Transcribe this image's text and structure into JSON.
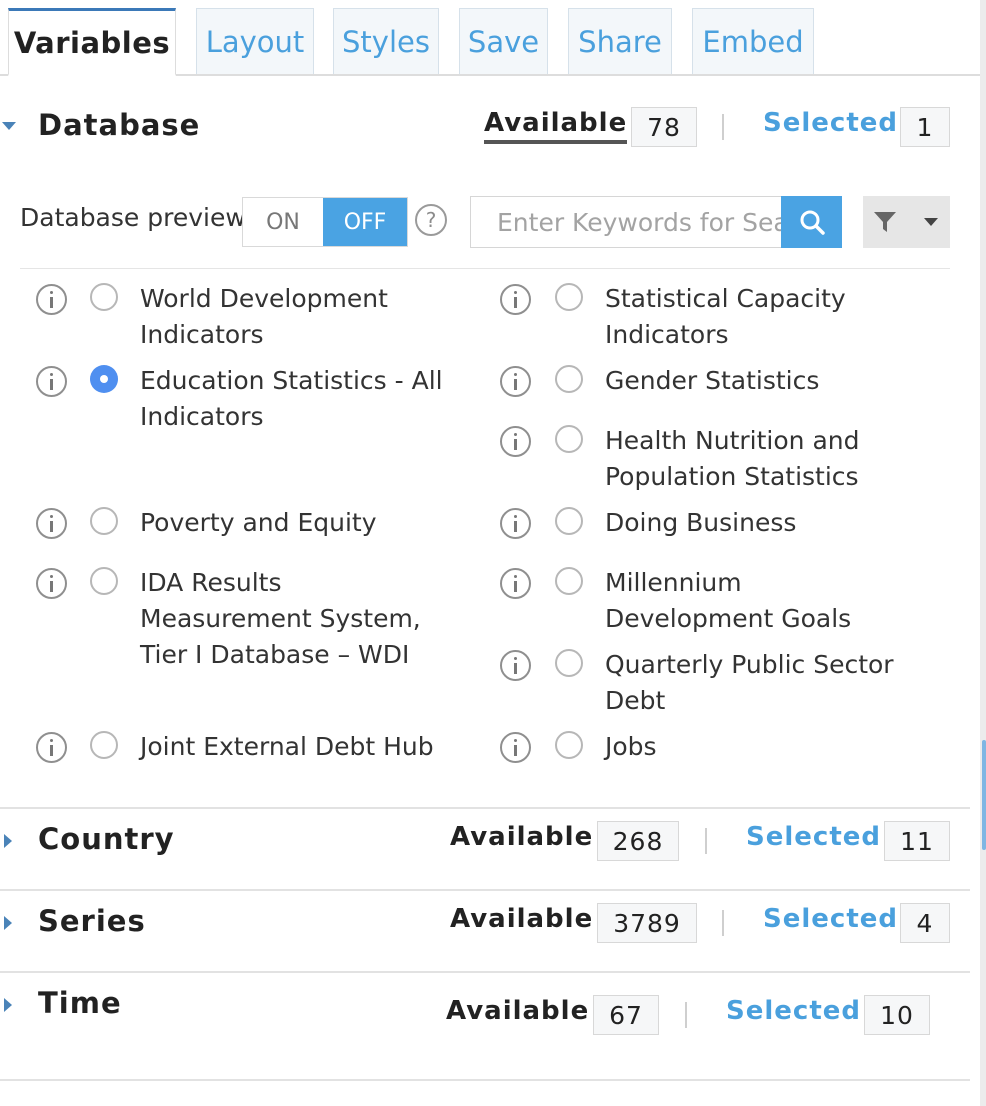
{
  "tabs": [
    "Variables",
    "Layout",
    "Styles",
    "Save",
    "Share",
    "Embed"
  ],
  "database": {
    "title": "Database",
    "available_label": "Available",
    "available_count": "78",
    "selected_label": "Selected",
    "selected_count": "1",
    "preview_label": "Database preview",
    "toggle_on": "ON",
    "toggle_off": "OFF",
    "search_placeholder": "Enter Keywords for Search",
    "items": [
      {
        "label": "World Development Indicators",
        "selected": false
      },
      {
        "label": "Statistical Capacity Indicators",
        "selected": false
      },
      {
        "label": "Education Statistics - All Indicators",
        "selected": true
      },
      {
        "label": "Gender Statistics",
        "selected": false
      },
      {
        "label": "Health Nutrition and Population Statistics",
        "selected": false
      },
      {
        "label": "Poverty and Equity",
        "selected": false
      },
      {
        "label": "Doing Business",
        "selected": false
      },
      {
        "label": "IDA Results Measurement System, Tier I Database – WDI",
        "selected": false
      },
      {
        "label": "Millennium Development Goals",
        "selected": false
      },
      {
        "label": "Quarterly Public Sector Debt",
        "selected": false
      },
      {
        "label": "Joint External Debt Hub",
        "selected": false
      },
      {
        "label": "Jobs",
        "selected": false
      }
    ]
  },
  "country": {
    "title": "Country",
    "available_label": "Available",
    "available_count": "268",
    "selected_label": "Selected",
    "selected_count": "11"
  },
  "series": {
    "title": "Series",
    "available_label": "Available",
    "available_count": "3789",
    "selected_label": "Selected",
    "selected_count": "4"
  },
  "time": {
    "title": "Time",
    "available_label": "Available",
    "available_count": "67",
    "selected_label": "Selected",
    "selected_count": "10"
  },
  "colors": {
    "accent": "#4aa3e3",
    "link": "#4aa0dd",
    "radio_selected": "#4f8ff0"
  }
}
